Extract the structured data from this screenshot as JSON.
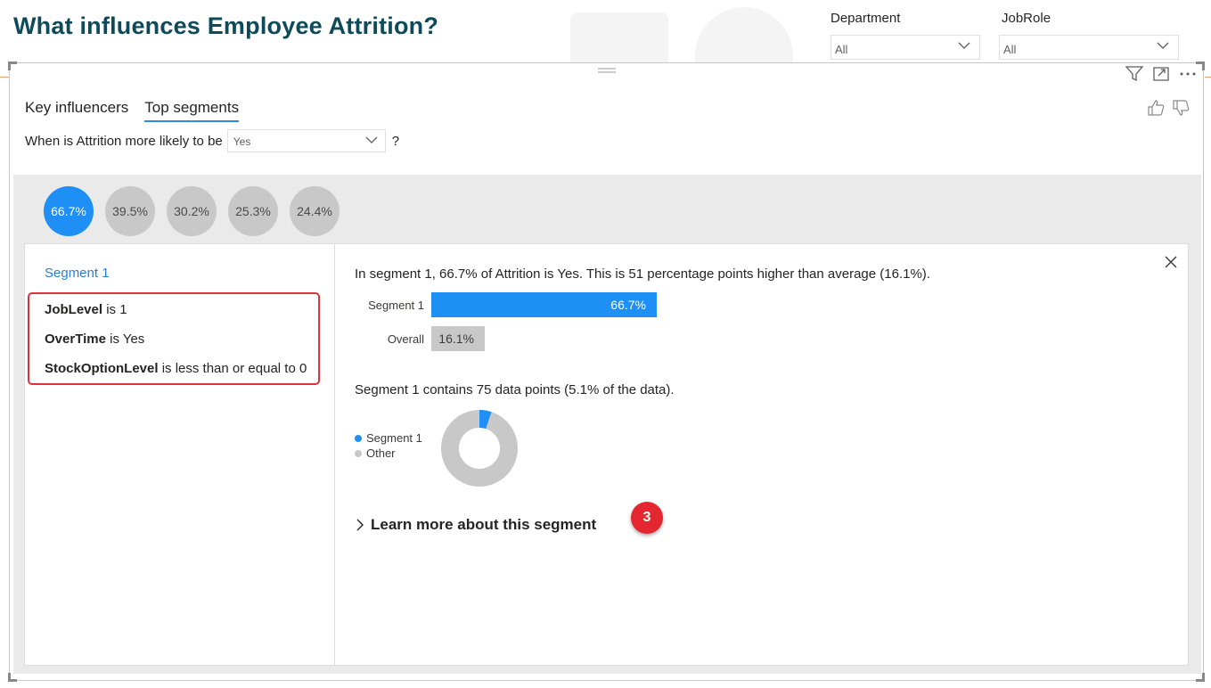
{
  "page": {
    "title": "What influences Employee Attrition?"
  },
  "filters": [
    {
      "label": "Department",
      "value": "All"
    },
    {
      "label": "JobRole",
      "value": "All"
    }
  ],
  "visual_header": {
    "icons": [
      "filter-icon",
      "focus-mode-icon",
      "more-options-icon"
    ]
  },
  "tabs": [
    {
      "label": "Key influencers",
      "active": false
    },
    {
      "label": "Top segments",
      "active": true
    }
  ],
  "feedback_icons": [
    "thumbs-up-icon",
    "thumbs-down-icon"
  ],
  "question": {
    "prefix": "When is Attrition more likely to be",
    "value": "Yes",
    "suffix": "?"
  },
  "segments": [
    "66.7%",
    "39.5%",
    "30.2%",
    "25.3%",
    "24.4%"
  ],
  "selected_segment": {
    "title": "Segment 1",
    "conditions": [
      {
        "field": "JobLevel",
        "rule": "is 1"
      },
      {
        "field": "OverTime",
        "rule": "is Yes"
      },
      {
        "field": "StockOptionLevel",
        "rule": "is less than or equal to 0"
      }
    ],
    "summary": "In segment 1, 66.7% of Attrition is Yes. This is 51 percentage points higher than average (16.1%).",
    "bars": [
      {
        "label": "Segment 1",
        "value_label": "66.7%",
        "value": 66.7
      },
      {
        "label": "Overall",
        "value_label": "16.1%",
        "value": 16.1
      }
    ],
    "contains": "Segment 1 contains 75 data points (5.1% of the data).",
    "legend": [
      {
        "label": "Segment 1",
        "color": "#1d8ff5"
      },
      {
        "label": "Other",
        "color": "#c8c8c8"
      }
    ],
    "donut_share": 0.051,
    "learn_more": "Learn more about this segment"
  },
  "step_badge": "3",
  "colors": {
    "accent": "#1d8ff5",
    "title": "#0e4a5a",
    "highlight": "#e0313c"
  }
}
